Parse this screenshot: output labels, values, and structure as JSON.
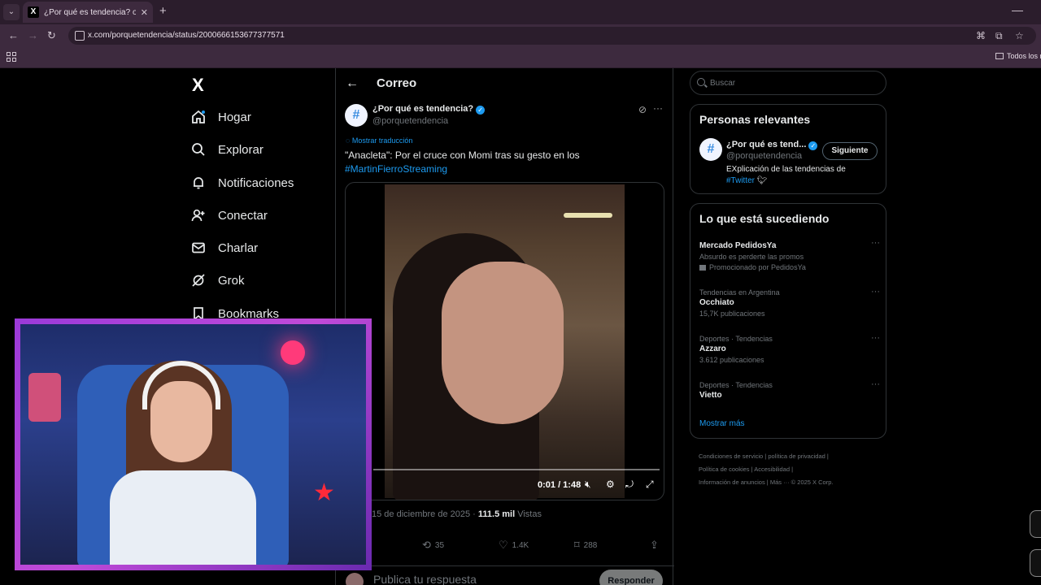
{
  "browser": {
    "tab_title": "¿Por qué es tendencia? on X: \"",
    "url": "x.com/porquetendencia/status/2000666153677377571",
    "bookmarks_folder": "Todos los m"
  },
  "sidebar": {
    "logo": "X",
    "items": [
      {
        "label": "Hogar",
        "icon": "home-icon"
      },
      {
        "label": "Explorar",
        "icon": "search-icon"
      },
      {
        "label": "Notificaciones",
        "icon": "bell-icon"
      },
      {
        "label": "Conectar",
        "icon": "add-person-icon"
      },
      {
        "label": "Charlar",
        "icon": "mail-icon"
      },
      {
        "label": "Grok",
        "icon": "grok-icon"
      },
      {
        "label": "Bookmarks",
        "icon": "bookmark-icon"
      }
    ]
  },
  "main": {
    "title": "Correo",
    "author": {
      "name": "¿Por qué es tendencia?",
      "handle": "@porquetendencia",
      "avatar_glyph": "#"
    },
    "translate_label": "Mostrar traducción",
    "text": "\"Anacleta\": Por el cruce con Momi tras su gesto en los",
    "hashtag": "#MartinFierroStreaming",
    "video": {
      "time": "0:01 / 1:48",
      "progress": 0.01
    },
    "meta_date": "15 de diciembre de 2025 · ",
    "meta_views_num": "111.5 mil",
    "meta_views_label": " Vistas",
    "actions": {
      "retweets": "35",
      "likes": "1.4K",
      "bookmarks": "288"
    },
    "reply_placeholder": "Publica tu respuesta",
    "reply_button": "Responder"
  },
  "right": {
    "search_placeholder": "Buscar",
    "relevant": {
      "title": "Personas relevantes",
      "name": "¿Por qué es tend...",
      "handle": "@porquetendencia",
      "follow": "Siguiente",
      "bio": "EXplicación de las tendencias de ",
      "bio_tag": "#Twitter"
    },
    "happening": {
      "title": "Lo que está sucediendo",
      "items": [
        {
          "top": "",
          "name": "Mercado PedidosYa",
          "sub": "Absurdo es perderte las promos",
          "promo": "Promocionado por PedidosYa"
        },
        {
          "top": "Tendencias en Argentina",
          "name": "Occhiato",
          "sub": "15,7K publicaciones"
        },
        {
          "top": "Deportes · Tendencias",
          "name": "Azzaro",
          "sub": "3.612 publicaciones"
        },
        {
          "top": "Deportes · Tendencias",
          "name": "Vietto",
          "sub": ""
        }
      ],
      "show_more": "Mostrar más"
    },
    "footer": {
      "line1": "Condiciones de servicio  |  política de privacidad  |",
      "line2": "Política de cookies  |  Accesibilidad  |",
      "line3": "Información de anuncios  |  Más ···  © 2025 X Corp."
    }
  },
  "colors": {
    "accent": "#1d9bf0",
    "browser_frame": "#3d2a3e",
    "webcam_border": "#b040d8"
  }
}
